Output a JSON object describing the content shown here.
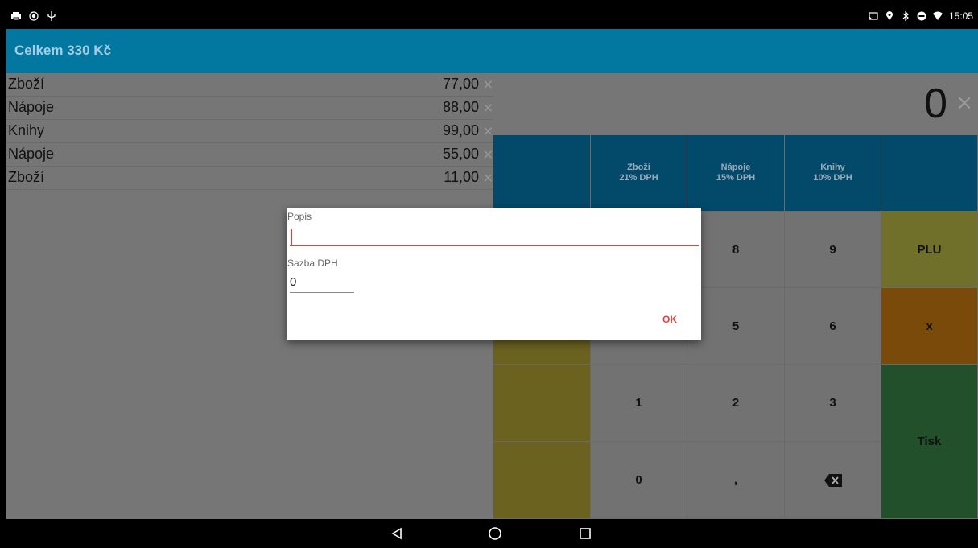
{
  "status_bar": {
    "left_icons": [
      "printer-icon",
      "location-target-icon",
      "usb-icon"
    ],
    "right_icons": [
      "cast-icon",
      "location-pin-icon",
      "bluetooth-icon",
      "do-not-disturb-icon",
      "wifi-icon"
    ],
    "time": "15:05"
  },
  "app_bar": {
    "title": "Celkem 330 Kč"
  },
  "items": [
    {
      "name": "Zboží",
      "price": "77,00"
    },
    {
      "name": "Nápoje",
      "price": "88,00"
    },
    {
      "name": "Knihy",
      "price": "99,00"
    },
    {
      "name": "Nápoje",
      "price": "55,00"
    },
    {
      "name": "Zboží",
      "price": "11,00"
    }
  ],
  "remove_glyph": "×",
  "display": {
    "value": "0",
    "clear_glyph": "×"
  },
  "keypad": {
    "categories": [
      {
        "name": "Zboží",
        "vat": "21% DPH"
      },
      {
        "name": "Nápoje",
        "vat": "15% DPH"
      },
      {
        "name": "Knihy",
        "vat": "10% DPH"
      }
    ],
    "keys": {
      "k8": "8",
      "k9": "9",
      "k5": "5",
      "k6": "6",
      "k1": "1",
      "k2": "2",
      "k3": "3",
      "k0": "0",
      "comma": ","
    },
    "plu": "PLU",
    "multiply": "x",
    "print": "Tisk"
  },
  "dialog": {
    "description_label": "Popis",
    "description_value": "",
    "vat_label": "Sazba DPH",
    "vat_value": "0",
    "ok_label": "OK"
  },
  "colors": {
    "app_bar": "#0277a0",
    "accent": "#e0433c",
    "category_key": "#03496a",
    "plu_key": "#70702a",
    "multiply_key": "#7a4a0a",
    "print_key": "#22502a"
  }
}
